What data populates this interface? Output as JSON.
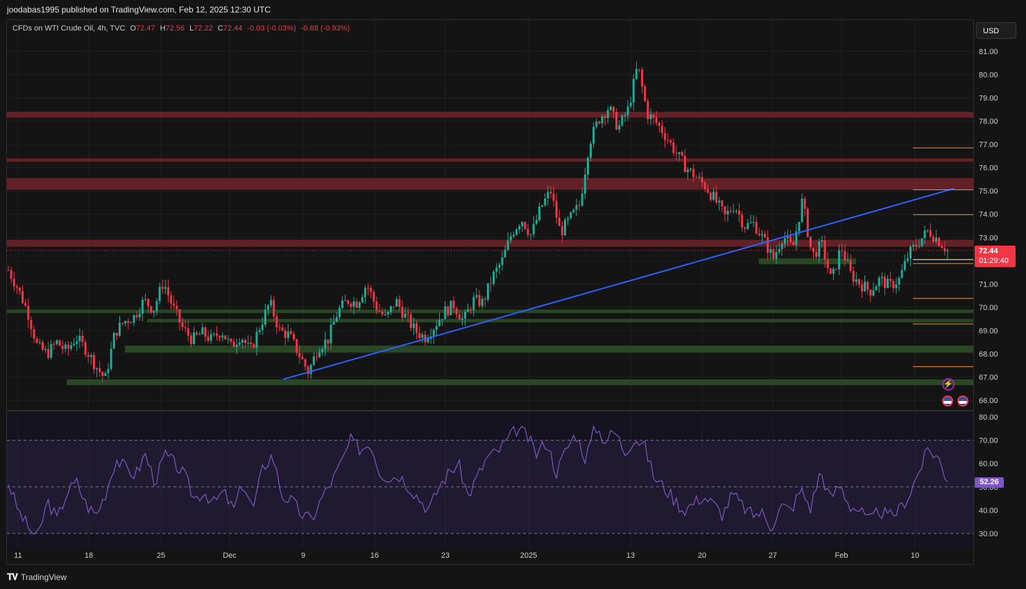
{
  "header": {
    "publisher": "joodabas1995 published on TradingView.com, Feb 12, 2025 12:30 UTC"
  },
  "legend": {
    "symbol": "CFDs on WTI Crude Oil, 4h, TVC",
    "o_label": "O",
    "o": "72.47",
    "h_label": "H",
    "h": "72.56",
    "l_label": "L",
    "l": "72.22",
    "c_label": "C",
    "c": "72.44",
    "change": "-0.03 (-0.03%)",
    "change2": "-0.68 (-0.93%)"
  },
  "currency_button": "USD",
  "last_price": {
    "value": "72.44",
    "countdown": "01:29:40"
  },
  "rsi_value": "52.26",
  "footer": {
    "brand": "TradingView"
  },
  "colors": {
    "up": "#22ab94",
    "down": "#f23645",
    "background": "#141414",
    "trendline": "#2962ff",
    "rsi": "#7e57c2",
    "resistance_zone": "#6b2228",
    "support_zone": "#2b4a26",
    "level_line": "#f7931a"
  },
  "icons": [
    "lightning-icon",
    "us-flag-icon",
    "us-flag-icon",
    "tradingview-logo-icon"
  ],
  "chart_data": [
    {
      "type": "candlestick",
      "title": "CFDs on WTI Crude Oil, 4h, TVC",
      "ylim": [
        65.5,
        81.6
      ],
      "y_ticks": [
        "81.00",
        "80.00",
        "79.00",
        "78.00",
        "77.00",
        "76.00",
        "75.00",
        "74.00",
        "73.00",
        "72.00",
        "71.00",
        "70.00",
        "69.00",
        "68.00",
        "67.00",
        "66.00"
      ],
      "x_ticks": [
        "11",
        "18",
        "25",
        "Dec",
        "9",
        "16",
        "23",
        "2025",
        "13",
        "20",
        "27",
        "Feb",
        "10"
      ],
      "price_path": [
        [
          0,
          71.6
        ],
        [
          1,
          70.8
        ],
        [
          2,
          69.8
        ],
        [
          3,
          68.3
        ],
        [
          4,
          68.0
        ],
        [
          5,
          68.5
        ],
        [
          6,
          68.1
        ],
        [
          7,
          68.7
        ],
        [
          8,
          68.2
        ],
        [
          9,
          67.5
        ],
        [
          10,
          66.9
        ],
        [
          11,
          68.9
        ],
        [
          12,
          69.4
        ],
        [
          13,
          69.6
        ],
        [
          14,
          70.3
        ],
        [
          15,
          69.9
        ],
        [
          16,
          71.1
        ],
        [
          17,
          70.0
        ],
        [
          18,
          69.1
        ],
        [
          19,
          68.6
        ],
        [
          20,
          68.9
        ],
        [
          21,
          68.6
        ],
        [
          22,
          69.0
        ],
        [
          23,
          68.3
        ],
        [
          24,
          68.8
        ],
        [
          25,
          68.1
        ],
        [
          26,
          69.2
        ],
        [
          27,
          70.2
        ],
        [
          28,
          69.0
        ],
        [
          29,
          68.8
        ],
        [
          30,
          68.0
        ],
        [
          31,
          67.2
        ],
        [
          32,
          68.3
        ],
        [
          33,
          68.6
        ],
        [
          34,
          69.8
        ],
        [
          35,
          70.3
        ],
        [
          36,
          70.2
        ],
        [
          37,
          71.0
        ],
        [
          38,
          70.0
        ],
        [
          39,
          69.5
        ],
        [
          40,
          70.3
        ],
        [
          41,
          69.6
        ],
        [
          42,
          69.0
        ],
        [
          43,
          68.7
        ],
        [
          44,
          69.2
        ],
        [
          45,
          69.8
        ],
        [
          46,
          70.1
        ],
        [
          47,
          69.4
        ],
        [
          48,
          70.3
        ],
        [
          49,
          70.2
        ],
        [
          50,
          71.3
        ],
        [
          51,
          72.0
        ],
        [
          52,
          73.2
        ],
        [
          53,
          73.8
        ],
        [
          54,
          73.1
        ],
        [
          55,
          74.3
        ],
        [
          56,
          75.0
        ],
        [
          57,
          73.2
        ],
        [
          58,
          73.8
        ],
        [
          59,
          74.4
        ],
        [
          60,
          77.1
        ],
        [
          61,
          78.1
        ],
        [
          62,
          78.6
        ],
        [
          63,
          77.7
        ],
        [
          64,
          78.5
        ],
        [
          65,
          80.4
        ],
        [
          66,
          78.3
        ],
        [
          67,
          77.9
        ],
        [
          68,
          77.3
        ],
        [
          69,
          76.6
        ],
        [
          70,
          76.0
        ],
        [
          71,
          75.6
        ],
        [
          72,
          75.2
        ],
        [
          73,
          74.6
        ],
        [
          74,
          73.9
        ],
        [
          75,
          74.4
        ],
        [
          76,
          73.5
        ],
        [
          77,
          73.6
        ],
        [
          78,
          72.9
        ],
        [
          79,
          72.1
        ],
        [
          80,
          73.1
        ],
        [
          81,
          72.5
        ],
        [
          82,
          74.6
        ],
        [
          83,
          72.2
        ],
        [
          84,
          72.7
        ],
        [
          85,
          71.1
        ],
        [
          86,
          72.6
        ],
        [
          87,
          71.4
        ],
        [
          88,
          71.0
        ],
        [
          89,
          70.7
        ],
        [
          90,
          71.2
        ],
        [
          91,
          70.9
        ],
        [
          92,
          71.2
        ],
        [
          93,
          72.3
        ],
        [
          94,
          72.8
        ],
        [
          95,
          73.3
        ],
        [
          96,
          72.9
        ],
        [
          97,
          72.44
        ]
      ],
      "trendline": {
        "from": [
          9,
          66.9
        ],
        "to": [
          96,
          75.1
        ]
      },
      "resistance_zones": [
        [
          78.15,
          78.4
        ],
        [
          76.25,
          76.4
        ],
        [
          75.05,
          75.55
        ],
        [
          72.6,
          72.9
        ]
      ],
      "support_zones": [
        [
          71.85,
          72.1
        ],
        [
          69.75,
          69.9
        ],
        [
          69.35,
          69.5
        ],
        [
          68.05,
          68.35
        ],
        [
          66.65,
          66.9
        ]
      ],
      "levels": [
        76.85,
        75.05,
        73.98,
        71.88,
        70.38,
        69.28,
        67.45
      ],
      "last": 72.44
    },
    {
      "type": "line",
      "title": "RSI",
      "ylim": [
        27.5,
        82
      ],
      "y_ticks": [
        "80.00",
        "70.00",
        "60.00",
        "50.00",
        "40.00",
        "30.00"
      ],
      "levels": [
        70,
        50,
        30
      ],
      "values": [
        52,
        40,
        33,
        28,
        44,
        36,
        48,
        52,
        42,
        38,
        48,
        62,
        58,
        55,
        64,
        52,
        64,
        60,
        55,
        45,
        48,
        43,
        48,
        40,
        52,
        40,
        58,
        64,
        46,
        44,
        38,
        36,
        45,
        52,
        60,
        70,
        66,
        69,
        56,
        54,
        55,
        50,
        45,
        40,
        50,
        56,
        60,
        46,
        55,
        63,
        65,
        70,
        75,
        72,
        64,
        70,
        56,
        66,
        73,
        62,
        76,
        70,
        74,
        65,
        71,
        68,
        54,
        50,
        45,
        40,
        43,
        46,
        43,
        38,
        47,
        42,
        38,
        39,
        33,
        42,
        40,
        49,
        41,
        57,
        45,
        51,
        42,
        40,
        35,
        40,
        37,
        40,
        46,
        56,
        66,
        63,
        52.26
      ]
    }
  ]
}
